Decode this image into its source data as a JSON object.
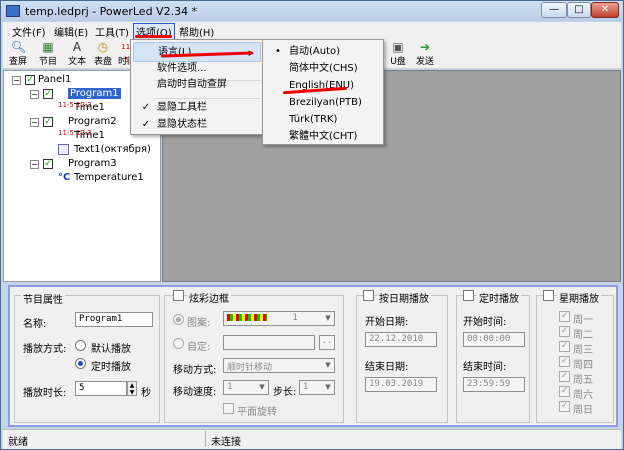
{
  "window": {
    "title": "temp.ledprj - PowerLed V2.34 *",
    "minimize": "—",
    "maximize": "□",
    "close": "✕"
  },
  "menubar": {
    "file": "文件(F)",
    "edit": "编辑(E)",
    "tools": "工具(T)",
    "options": "选项(O)",
    "help": "帮助(H)"
  },
  "toolbar": {
    "screen": "查屏",
    "program": "节目",
    "text": "文本",
    "clock": "表盘",
    "time": "时间",
    "udisk": "U盘",
    "send": "发送"
  },
  "options_menu": {
    "language": "语言(L)",
    "software_options": "软件选项...",
    "auto_start": "启动时自动查屏",
    "show_toolbar": "显隐工具栏",
    "show_statusbar": "显隐状态栏",
    "checkmark": "✓"
  },
  "language_menu": {
    "bullet": "•",
    "items": [
      "自动(Auto)",
      "简体中文(CHS)",
      "English(ENU)",
      "Brezilyan(PTB)",
      "Türk(TRK)",
      "繁體中文(CHT)"
    ]
  },
  "tree": {
    "panel": "Panel1",
    "program1": "Program1",
    "time1": "Time1",
    "program2": "Program2",
    "time1b": "Time1",
    "text1": "Text1(октября)",
    "program3": "Program3",
    "temperature1": "Temperature1",
    "collapse": "−",
    "check": "✓",
    "clock_glyph": "11-5 12:3",
    "temp_glyph": "°C"
  },
  "program_props": {
    "title": "节目属性",
    "name_label": "名称:",
    "name_value": "Program1",
    "mode_label": "播放方式:",
    "mode_default": "默认播放",
    "mode_timed": "定时播放",
    "duration_label": "播放时长:",
    "duration_value": "5",
    "duration_unit": "秒"
  },
  "border": {
    "title": "炫彩边框",
    "pattern_label": "图案:",
    "pattern_value": "1",
    "custom_label": "自定:",
    "custom_btn": "..",
    "move_label": "移动方式:",
    "move_value": "顺时针移动",
    "speed_label": "移动速度:",
    "speed_value": "1",
    "step_label": "步长:",
    "step_value": "1",
    "rotate_label": "平面旋转"
  },
  "date_play": {
    "title": "按日期播放",
    "start_label": "开始日期:",
    "start_value": "22.12.2010",
    "end_label": "结束日期:",
    "end_value": "19.03.2019"
  },
  "timed_play": {
    "title": "定时播放",
    "start_label": "开始时间:",
    "start_value": "00:00:00",
    "end_label": "结束时间:",
    "end_value": "23:59:59"
  },
  "weekly": {
    "title": "星期播放",
    "days": [
      "周一",
      "周二",
      "周三",
      "周四",
      "周五",
      "周六",
      "周日"
    ]
  },
  "status": {
    "left": "就绪",
    "right": "未连接"
  },
  "colors": {
    "accent": "#3165ce",
    "annotation": "#e00000"
  }
}
